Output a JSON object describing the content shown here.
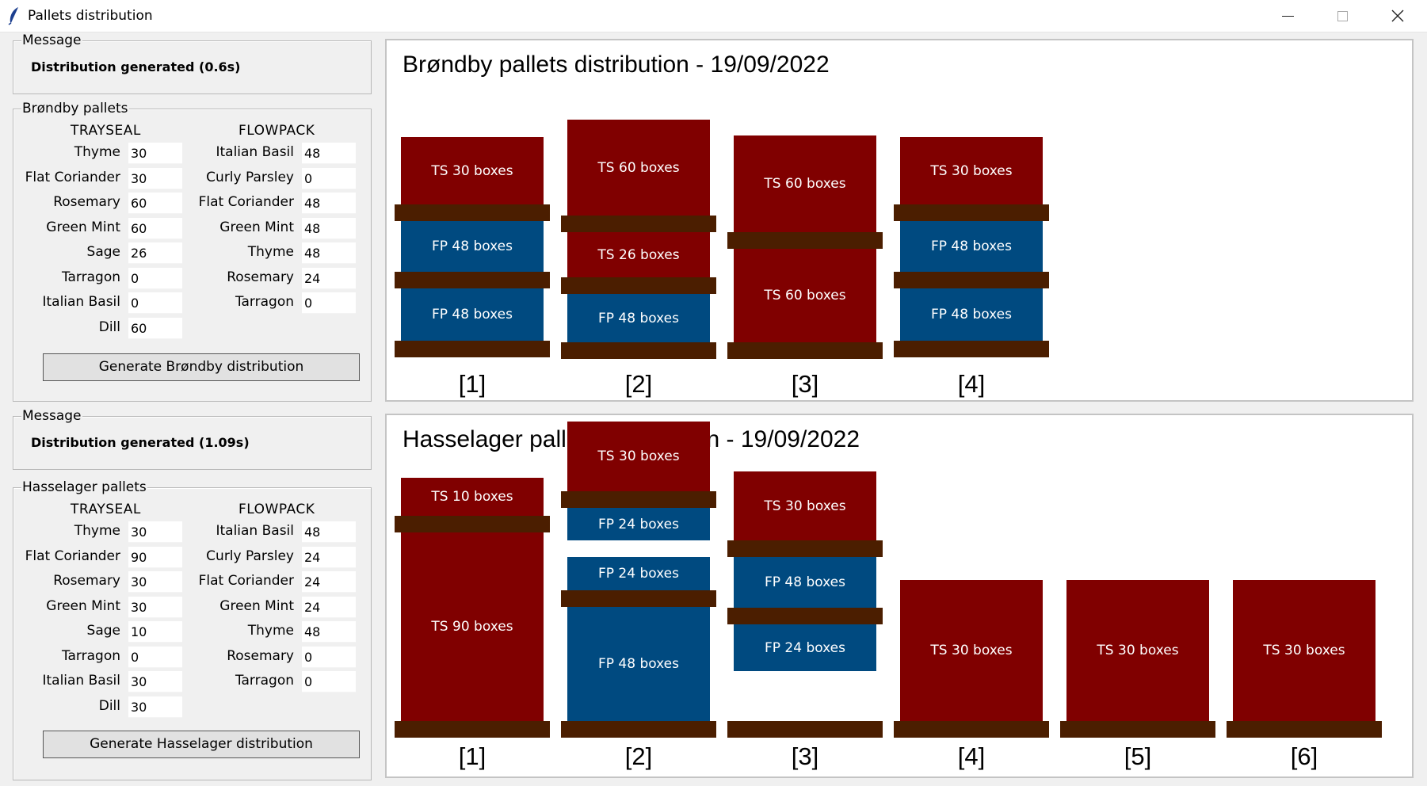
{
  "window": {
    "title": "Pallets distribution",
    "controls": {
      "minimize": "minimize-icon",
      "maximize": "maximize-icon",
      "close": "close-icon"
    }
  },
  "colors": {
    "trayseal_box": "#800000",
    "flowpack_box": "#004a80",
    "pallet_board": "#4b1e00"
  },
  "brondby": {
    "message_title": "Message",
    "message": "Distribution generated (0.6s)",
    "pallets_title": "Brøndby pallets",
    "trayseal_header": "TRAYSEAL",
    "flowpack_header": "FLOWPACK",
    "trayseal": [
      {
        "label": "Thyme",
        "value": "30"
      },
      {
        "label": "Flat Coriander",
        "value": "30"
      },
      {
        "label": "Rosemary",
        "value": "60"
      },
      {
        "label": "Green Mint",
        "value": "60"
      },
      {
        "label": "Sage",
        "value": "26"
      },
      {
        "label": "Tarragon",
        "value": "0"
      },
      {
        "label": "Italian Basil",
        "value": "0"
      },
      {
        "label": "Dill",
        "value": "60"
      }
    ],
    "flowpack": [
      {
        "label": "Italian Basil",
        "value": "48"
      },
      {
        "label": "Curly Parsley",
        "value": "0"
      },
      {
        "label": "Flat Coriander",
        "value": "48"
      },
      {
        "label": "Green Mint",
        "value": "48"
      },
      {
        "label": "Thyme",
        "value": "48"
      },
      {
        "label": "Rosemary",
        "value": "24"
      },
      {
        "label": "Tarragon",
        "value": "0"
      }
    ],
    "button": "Generate Brøndby distribution",
    "canvas_title": "Brøndby pallets distribution - 19/09/2022",
    "pallets": [
      {
        "label": "[1]",
        "boxes": [
          "TS 30 boxes",
          "FP 48 boxes",
          "FP 48 boxes"
        ]
      },
      {
        "label": "[2]",
        "boxes": [
          "TS 60 boxes",
          "TS 26 boxes",
          "FP 48 boxes"
        ]
      },
      {
        "label": "[3]",
        "boxes": [
          "TS 60 boxes",
          "TS 60 boxes"
        ]
      },
      {
        "label": "[4]",
        "boxes": [
          "TS 30 boxes",
          "FP 48 boxes",
          "FP 48 boxes"
        ]
      }
    ]
  },
  "hasselager": {
    "message_title": "Message",
    "message": "Distribution generated (1.09s)",
    "pallets_title": "Hasselager pallets",
    "trayseal_header": "TRAYSEAL",
    "flowpack_header": "FLOWPACK",
    "trayseal": [
      {
        "label": "Thyme",
        "value": "30"
      },
      {
        "label": "Flat Coriander",
        "value": "90"
      },
      {
        "label": "Rosemary",
        "value": "30"
      },
      {
        "label": "Green Mint",
        "value": "30"
      },
      {
        "label": "Sage",
        "value": "10"
      },
      {
        "label": "Tarragon",
        "value": "0"
      },
      {
        "label": "Italian Basil",
        "value": "30"
      },
      {
        "label": "Dill",
        "value": "30"
      }
    ],
    "flowpack": [
      {
        "label": "Italian Basil",
        "value": "48"
      },
      {
        "label": "Curly Parsley",
        "value": "24"
      },
      {
        "label": "Flat Coriander",
        "value": "24"
      },
      {
        "label": "Green Mint",
        "value": "24"
      },
      {
        "label": "Thyme",
        "value": "48"
      },
      {
        "label": "Rosemary",
        "value": "0"
      },
      {
        "label": "Tarragon",
        "value": "0"
      }
    ],
    "button": "Generate Hasselager distribution",
    "canvas_title": "Hasselager pallets distribution - 19/09/2022",
    "pallets": [
      {
        "label": "[1]",
        "boxes": [
          "TS 10 boxes",
          "TS 90 boxes"
        ]
      },
      {
        "label": "[2]",
        "boxes": [
          "TS 30 boxes",
          "FP 24 boxes",
          "FP 24 boxes",
          "FP 48 boxes"
        ]
      },
      {
        "label": "[3]",
        "boxes": [
          "TS 30 boxes",
          "FP 48 boxes",
          "FP 24 boxes"
        ]
      },
      {
        "label": "[4]",
        "boxes": [
          "TS 30 boxes"
        ]
      },
      {
        "label": "[5]",
        "boxes": [
          "TS 30 boxes"
        ]
      },
      {
        "label": "[6]",
        "boxes": [
          "TS 30 boxes"
        ]
      }
    ]
  }
}
